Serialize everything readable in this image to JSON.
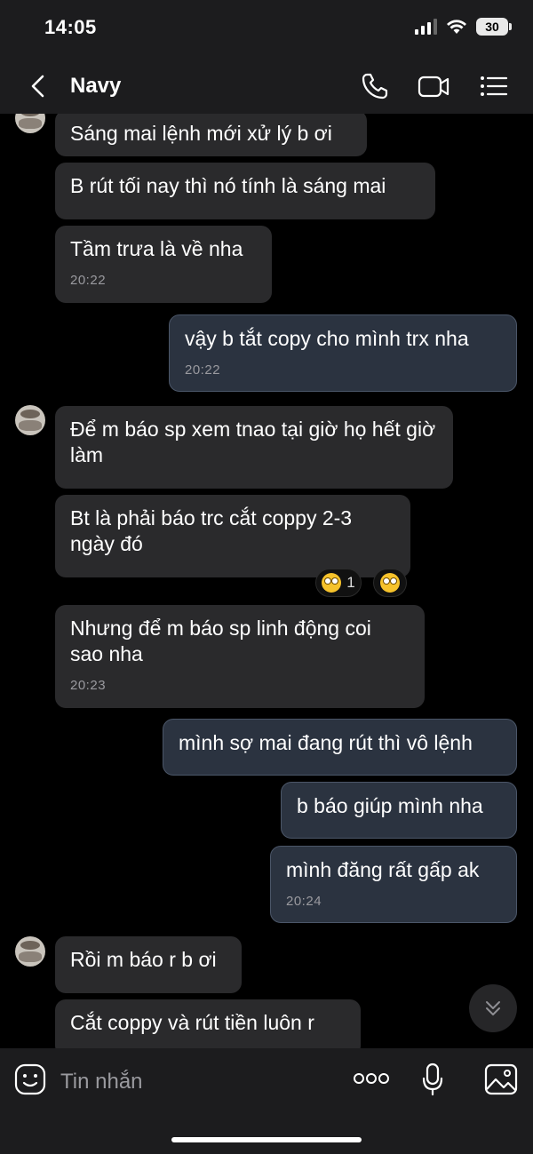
{
  "status": {
    "time": "14:05",
    "battery": "30"
  },
  "header": {
    "title": "Navy"
  },
  "messages": [
    {
      "text": "Sáng mai lệnh mới xử lý b ơi"
    },
    {
      "text": "B rút tối nay thì nó tính là sáng mai"
    },
    {
      "text": "Tầm trưa là về nha",
      "time": "20:22"
    },
    {
      "text": "vậy b tắt copy cho mình trx nha",
      "time": "20:22"
    },
    {
      "text": "Để m báo sp xem tnao tại giờ họ hết giờ làm"
    },
    {
      "text": "Bt là phải báo trc cắt coppy 2-3 ngày đó"
    },
    {
      "text": "Nhưng để m báo sp linh động coi sao nha",
      "time": "20:23"
    },
    {
      "text": "mình sợ mai đang rút thì vô lệnh"
    },
    {
      "text": "b báo giúp mình nha"
    },
    {
      "text": "mình đăng rất gấp ak",
      "time": "20:24"
    },
    {
      "text": "Rồi m báo r b ơi"
    },
    {
      "text": "Cắt coppy và rút tiền luôn r"
    }
  ],
  "reaction": {
    "count": "1"
  },
  "composer": {
    "placeholder": "Tin nhắn"
  }
}
